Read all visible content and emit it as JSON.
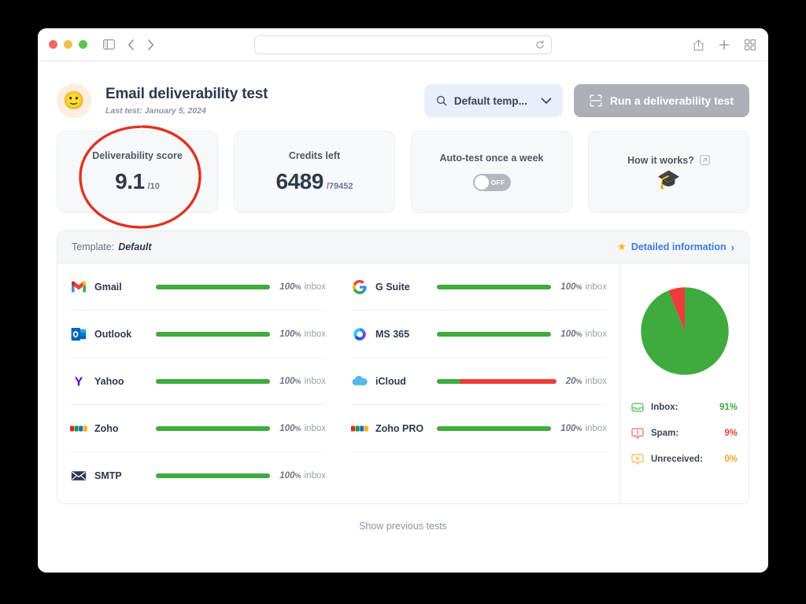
{
  "browser": {
    "url_value": "",
    "url_placeholder": "",
    "reload_icon": "reload-icon",
    "sidebar_icon": "sidebar-toggle-icon",
    "back_icon": "back-arrow-icon",
    "forward_icon": "forward-arrow-icon",
    "share_icon": "share-icon",
    "new_tab_icon": "plus-icon",
    "tab_overview_icon": "tab-overview-icon"
  },
  "header": {
    "avatar_emoji": "🙂",
    "title": "Email deliverability test",
    "last_test": "Last test: January 5, 2024",
    "template_select": {
      "value": "Default temp...",
      "search_icon": "search-icon",
      "chevron_icon": "chevron-down-icon"
    },
    "run_button": {
      "label": "Run a deliverability test",
      "icon": "scan-icon"
    }
  },
  "cards": [
    {
      "label": "Deliverability score",
      "value": "9.1",
      "suffix": "/10",
      "type": "value"
    },
    {
      "label": "Credits left",
      "value": "6489",
      "suffix": "/79452",
      "type": "value"
    },
    {
      "label": "Auto-test once a week",
      "type": "toggle",
      "toggle_state": "OFF"
    },
    {
      "label": "How it works?",
      "type": "link",
      "external_icon": "external-link-icon",
      "emoji": "🎓"
    }
  ],
  "panel": {
    "template_label": "Template:",
    "template_value": "Default",
    "detailed_link": "Detailed information",
    "star_icon": "star-icon",
    "chevron_icon": "chevron-right-icon",
    "inbox_word": "inbox",
    "percent_unit": "%"
  },
  "providers_left": [
    {
      "name": "Gmail",
      "icon": "gmail-icon",
      "percent": "100",
      "green_pct": 100
    },
    {
      "name": "Outlook",
      "icon": "outlook-icon",
      "percent": "100",
      "green_pct": 100
    },
    {
      "name": "Yahoo",
      "icon": "yahoo-icon",
      "percent": "100",
      "green_pct": 100
    },
    {
      "name": "Zoho",
      "icon": "zoho-icon",
      "percent": "100",
      "green_pct": 100
    },
    {
      "name": "SMTP",
      "icon": "smtp-icon",
      "percent": "100",
      "green_pct": 100
    }
  ],
  "providers_right": [
    {
      "name": "G Suite",
      "icon": "gsuite-icon",
      "percent": "100",
      "green_pct": 100
    },
    {
      "name": "MS 365",
      "icon": "ms365-icon",
      "percent": "100",
      "green_pct": 100
    },
    {
      "name": "iCloud",
      "icon": "icloud-icon",
      "percent": "20",
      "green_pct": 20
    },
    {
      "name": "Zoho PRO",
      "icon": "zoho-icon",
      "percent": "100",
      "green_pct": 100
    }
  ],
  "chart_data": {
    "type": "pie",
    "title": "",
    "categories": [
      "Inbox",
      "Spam",
      "Unreceived"
    ],
    "values": [
      91,
      9,
      0
    ],
    "labels": [
      "91%",
      "9%",
      "0%"
    ],
    "colors": [
      "#3fab3f",
      "#e8413c",
      "#f0a324"
    ],
    "legend_position": "below",
    "legend": [
      {
        "name": "Inbox:",
        "value": "91%",
        "color": "#3fab3f",
        "icon": "inbox-icon"
      },
      {
        "name": "Spam:",
        "value": "9%",
        "color": "#e8413c",
        "icon": "spam-alert-icon"
      },
      {
        "name": "Unreceived:",
        "value": "0%",
        "color": "#f0a324",
        "icon": "unreceived-icon"
      }
    ]
  },
  "footer": {
    "show_previous": "Show previous tests"
  },
  "annotation": {
    "shape": "ellipse",
    "color": "#e03421",
    "target": "deliverability-score-card"
  }
}
